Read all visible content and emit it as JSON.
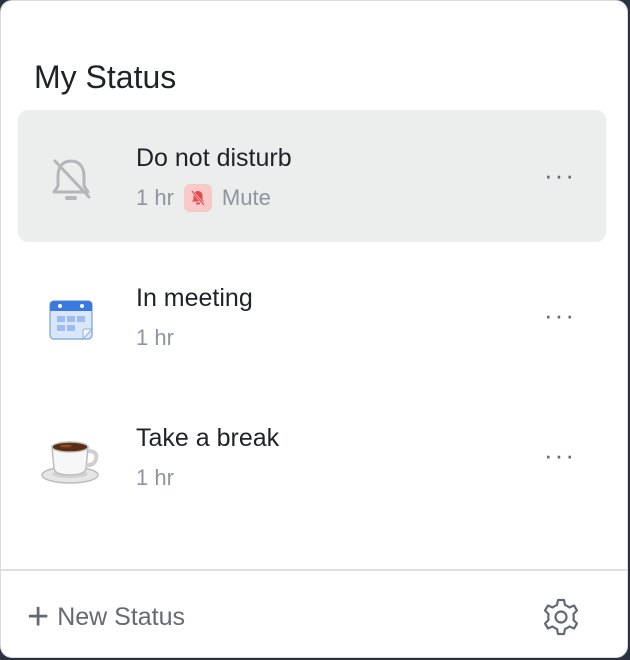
{
  "header": {
    "title": "My Status"
  },
  "statuses": [
    {
      "name": "Do not disturb",
      "duration": "1 hr",
      "extra": "Mute",
      "icon": "bell-off-icon",
      "active": true
    },
    {
      "name": "In meeting",
      "duration": "1 hr",
      "icon": "calendar-icon",
      "active": false
    },
    {
      "name": "Take a break",
      "duration": "1 hr",
      "icon": "coffee-cup-icon",
      "active": false
    }
  ],
  "more_label": "···",
  "footer": {
    "plus_symbol": "+",
    "new_status_label": "New Status",
    "settings_icon": "gear-icon"
  },
  "colors": {
    "mute_accent": "#e5484d",
    "mute_badge_bg": "#f8c9c9",
    "active_row_bg": "#eceeee",
    "calendar_blue": "#3a7ae0"
  }
}
